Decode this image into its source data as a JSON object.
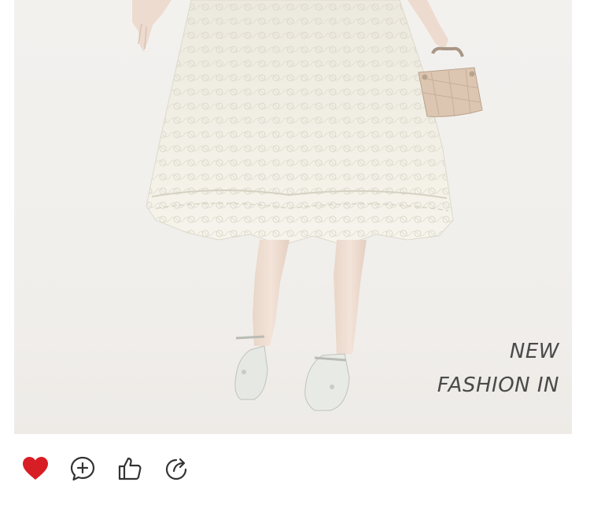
{
  "banner": {
    "line1": "NEW",
    "line2": "FASHION IN"
  },
  "actions": [
    {
      "name": "like",
      "icon": "heart-icon",
      "active": true,
      "color": "#d81e25"
    },
    {
      "name": "comment",
      "icon": "comment-add-icon",
      "active": false,
      "color": "#333333"
    },
    {
      "name": "thumbs-up",
      "icon": "thumbs-up-icon",
      "active": false,
      "color": "#333333"
    },
    {
      "name": "share",
      "icon": "share-icon",
      "active": false,
      "color": "#333333"
    }
  ]
}
